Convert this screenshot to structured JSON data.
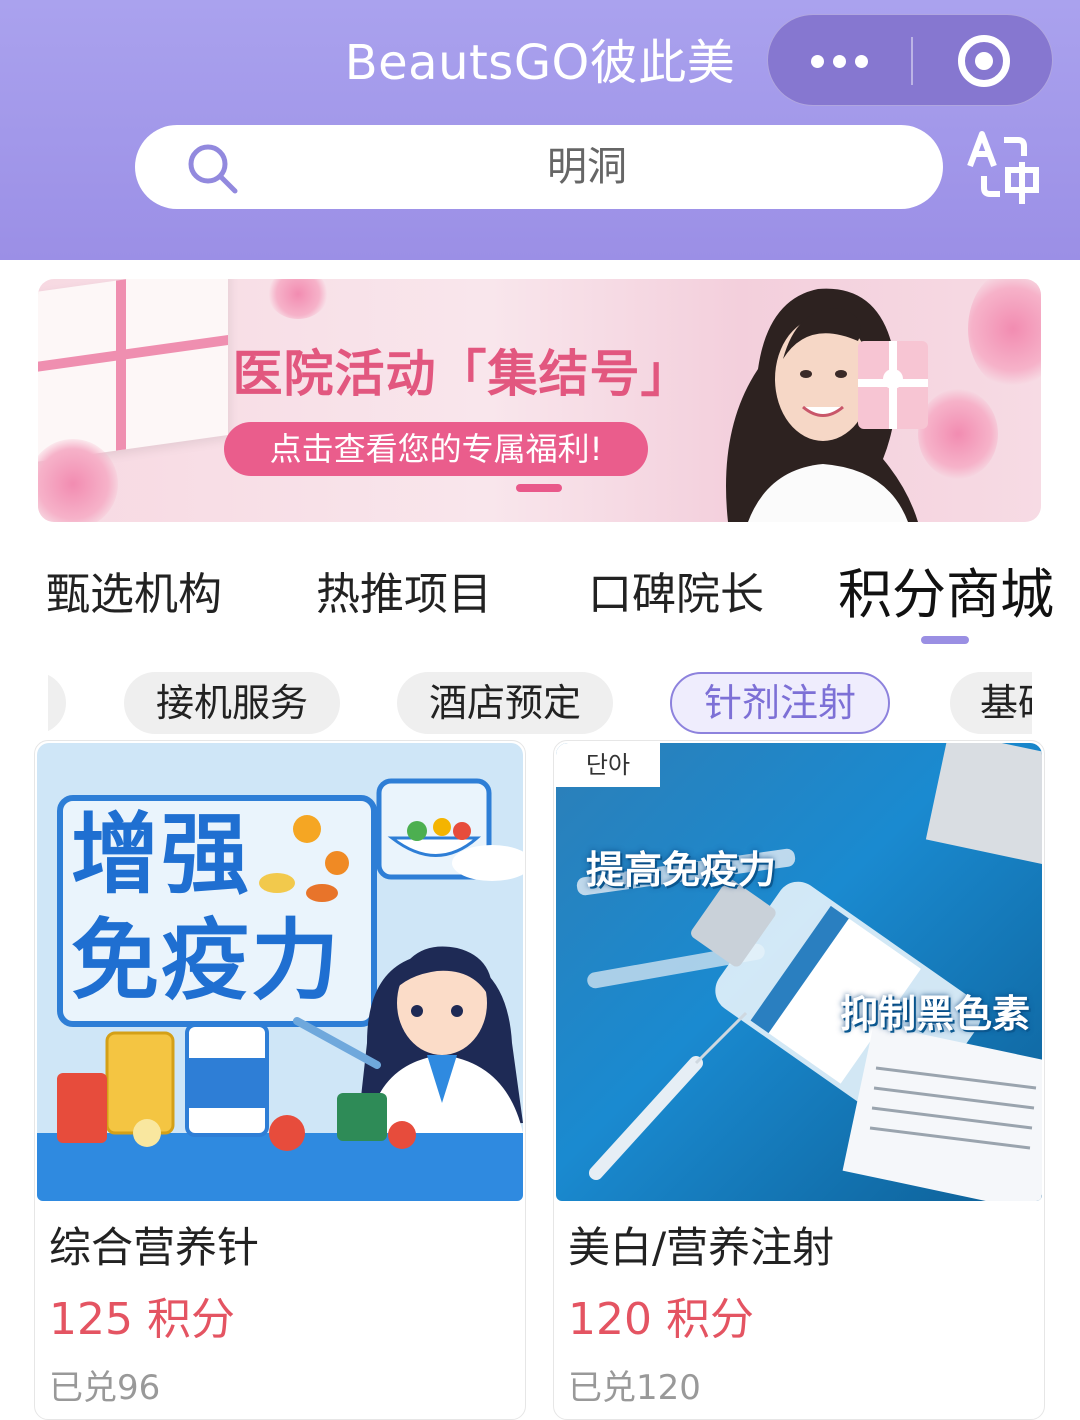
{
  "header": {
    "app_title": "BeautsGO彼此美",
    "search_placeholder": "明洞"
  },
  "banner": {
    "title": "医院活动「集结号」",
    "subtitle": "点击查看您的专属福利!"
  },
  "tabs": [
    {
      "label": "甄选机构",
      "active": false
    },
    {
      "label": "热推项目",
      "active": false
    },
    {
      "label": "口碑院长",
      "active": false
    },
    {
      "label": "积分商城",
      "active": true
    }
  ],
  "chips": [
    {
      "label": "接机服务",
      "active": false
    },
    {
      "label": "酒店预定",
      "active": false
    },
    {
      "label": "针剂注射",
      "active": true
    },
    {
      "label": "基础",
      "active": false
    }
  ],
  "products": [
    {
      "title": "综合营养针",
      "price": "125 积分",
      "sold": "已兑96",
      "image_text": [
        "增强",
        "免疫力"
      ]
    },
    {
      "title": "美白/营养注射",
      "price": "120 积分",
      "sold": "已兑120",
      "image_text": [
        "提高免疫力",
        "抑制黑色素"
      ],
      "brand_tag": "단아"
    }
  ],
  "colors": {
    "header": "#a89fee",
    "accent": "#8d82dd",
    "price": "#e45462"
  }
}
